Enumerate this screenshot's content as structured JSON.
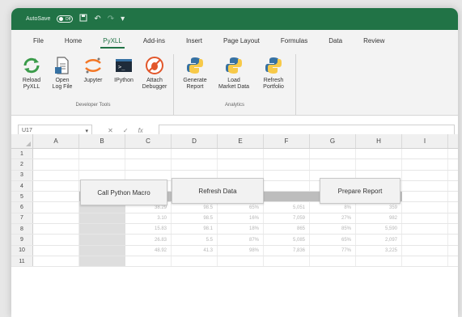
{
  "titlebar": {
    "autosave_label": "AutoSave",
    "toggle_state": "Off",
    "icons": [
      "save-icon",
      "undo-icon",
      "redo-icon",
      "customize-icon"
    ]
  },
  "tabs": [
    {
      "label": "File"
    },
    {
      "label": "Home"
    },
    {
      "label": "PyXLL",
      "active": true
    },
    {
      "label": "Add-ins"
    },
    {
      "label": "Insert"
    },
    {
      "label": "Page Layout"
    },
    {
      "label": "Formulas"
    },
    {
      "label": "Data"
    },
    {
      "label": "Review"
    }
  ],
  "ribbon": {
    "groups": [
      {
        "title": "Developer Tools",
        "buttons": [
          {
            "label": "Reload\nPyXLL",
            "icon": "reload-icon"
          },
          {
            "label": "Open\nLog File",
            "icon": "log-file-icon"
          },
          {
            "label": "Jupyter",
            "icon": "jupyter-icon"
          },
          {
            "label": "IPython",
            "icon": "ipython-icon"
          },
          {
            "label": "Attach\nDebugger",
            "icon": "debugger-icon"
          }
        ]
      },
      {
        "title": "Analytics",
        "buttons": [
          {
            "label": "Generate\nReport",
            "icon": "python-icon"
          },
          {
            "label": "Load\nMarket Data",
            "icon": "python-icon"
          },
          {
            "label": "Refresh\nPortfolio",
            "icon": "python-icon"
          }
        ]
      }
    ]
  },
  "formula_bar": {
    "name_box": "U17",
    "fx": "fx",
    "value": ""
  },
  "columns": [
    "A",
    "B",
    "C",
    "D",
    "E",
    "F",
    "G",
    "H",
    "I"
  ],
  "rows": [
    "1",
    "2",
    "3",
    "4",
    "5",
    "6",
    "7",
    "8",
    "9",
    "10",
    "11"
  ],
  "buttons": {
    "macro": "Call Python Macro",
    "refresh": "Refresh Data",
    "report": "Prepare Report"
  },
  "table_rows": [
    [
      "38.29",
      "98.5",
      "65%",
      "5,051",
      "8%",
      "359"
    ],
    [
      "3.10",
      "98.5",
      "16%",
      "7,059",
      "27%",
      "982"
    ],
    [
      "15.83",
      "98.1",
      "18%",
      "865",
      "85%",
      "5,590"
    ],
    [
      "26.83",
      "5.5",
      "87%",
      "5,085",
      "65%",
      "2,097"
    ],
    [
      "48.92",
      "41.3",
      "98%",
      "7,836",
      "77%",
      "3,225"
    ],
    [
      "",
      "",
      "",
      "",
      "",
      ""
    ]
  ],
  "colors": {
    "brand": "#217346",
    "python_blue": "#3671a3",
    "python_yellow": "#f7c948",
    "header_band": "#bdbdbd"
  }
}
